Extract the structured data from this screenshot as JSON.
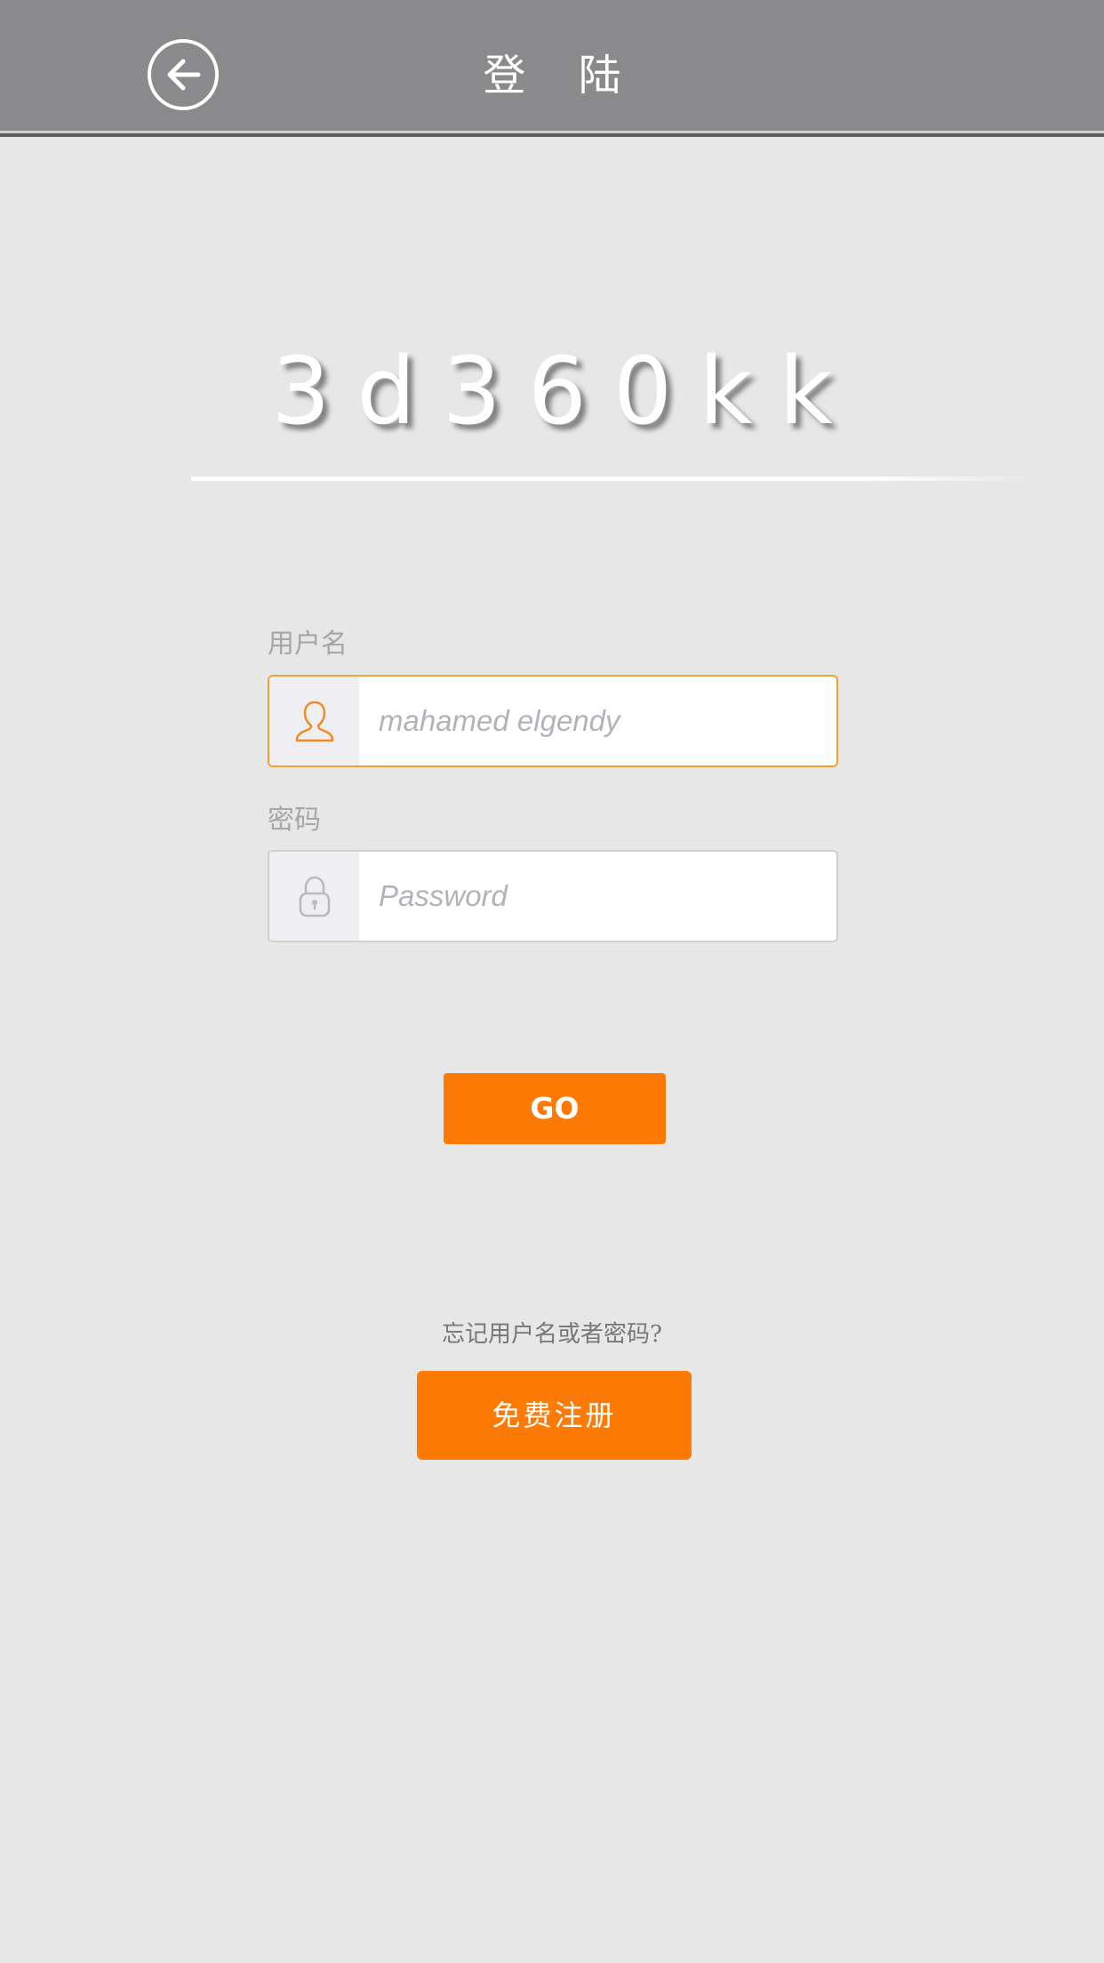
{
  "header": {
    "title": "登 陆",
    "back_icon": "arrow-left-circle-icon"
  },
  "logo": {
    "text": "3d360kk"
  },
  "form": {
    "username": {
      "label": "用户名",
      "placeholder": "mahamed elgendy",
      "value": "",
      "icon": "user-icon"
    },
    "password": {
      "label": "密码",
      "placeholder": "Password",
      "value": "",
      "icon": "lock-icon"
    },
    "submit_label": "GO"
  },
  "footer": {
    "forgot_text": "忘记用户名或者密码?",
    "register_label": "免费注册"
  },
  "colors": {
    "accent": "#fd7b04",
    "header_bg": "#8a8a8c",
    "page_bg": "#e7e7e7",
    "active_border": "#f5a033"
  }
}
